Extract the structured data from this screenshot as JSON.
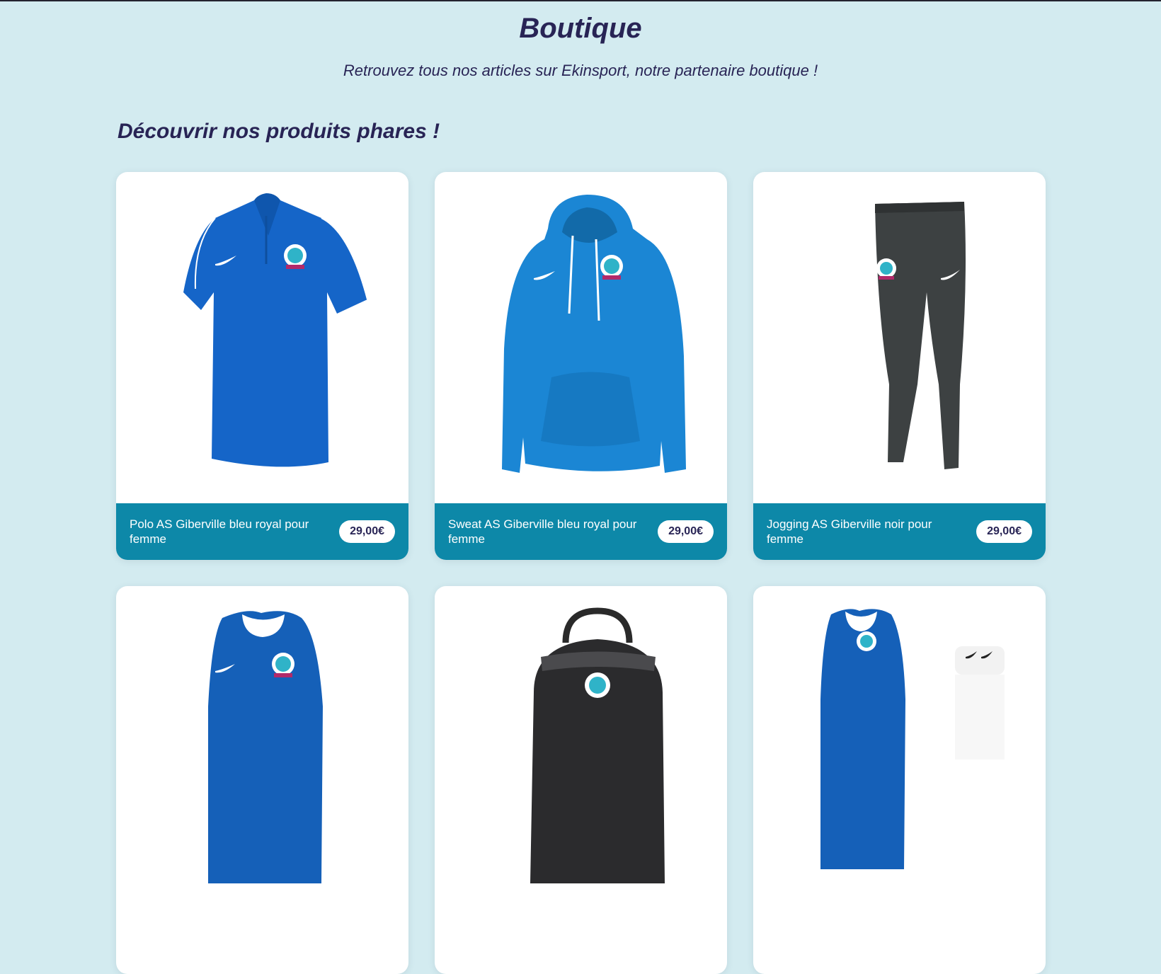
{
  "page": {
    "title": "Boutique",
    "subtitle": "Retrouvez tous nos articles sur Ekinsport, notre partenaire boutique !",
    "section_heading": "Découvrir nos produits phares !"
  },
  "colors": {
    "background": "#d3ebf0",
    "heading": "#282455",
    "card_footer": "#0d88a8",
    "royal_blue": "#1565c8",
    "sweat_blue": "#1b86d4",
    "jogging": "#3d4142"
  },
  "products": [
    {
      "name": "Polo AS Giberville bleu royal pour femme",
      "price": "29,00€",
      "image_icon": "polo-shirt-icon"
    },
    {
      "name": "Sweat AS Giberville bleu royal pour femme",
      "price": "29,00€",
      "image_icon": "hoodie-icon"
    },
    {
      "name": "Jogging AS Giberville noir pour femme",
      "price": "29,00€",
      "image_icon": "jogging-pants-icon"
    },
    {
      "image_icon": "tank-top-icon"
    },
    {
      "image_icon": "backpack-icon"
    },
    {
      "image_icon": "tank-top-and-socks-icon"
    }
  ]
}
